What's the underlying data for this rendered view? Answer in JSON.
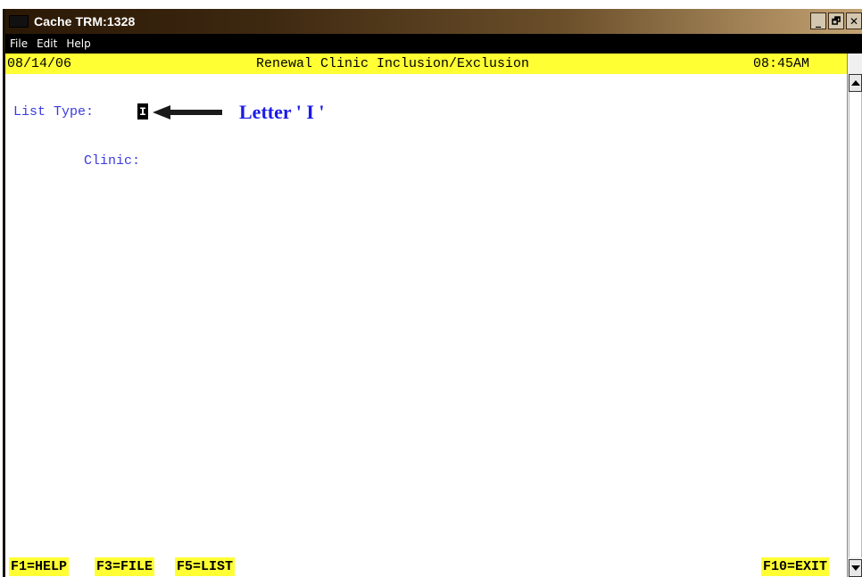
{
  "window": {
    "title": "Cache TRM:1328",
    "controls": {
      "minimize": "_",
      "restore": "🗗",
      "close": "✕"
    }
  },
  "menu": {
    "items": [
      "File",
      "Edit",
      "Help"
    ]
  },
  "header": {
    "date": "08/14/06",
    "title": "Renewal Clinic Inclusion/Exclusion",
    "time": "08:45AM",
    "color": "#ffff33"
  },
  "form": {
    "list_type_label": "List Type:",
    "list_type_value": "I",
    "clinic_label": "Clinic:",
    "label_color": "#3a3ae0"
  },
  "annotation": {
    "text": "Letter ' I '",
    "color": "#1a1ae6",
    "arrow_icon": "left-arrow-icon"
  },
  "footer": {
    "help": "F1=HELP",
    "file": "F3=FILE",
    "list": "F5=LIST",
    "exit": "F10=EXIT"
  }
}
